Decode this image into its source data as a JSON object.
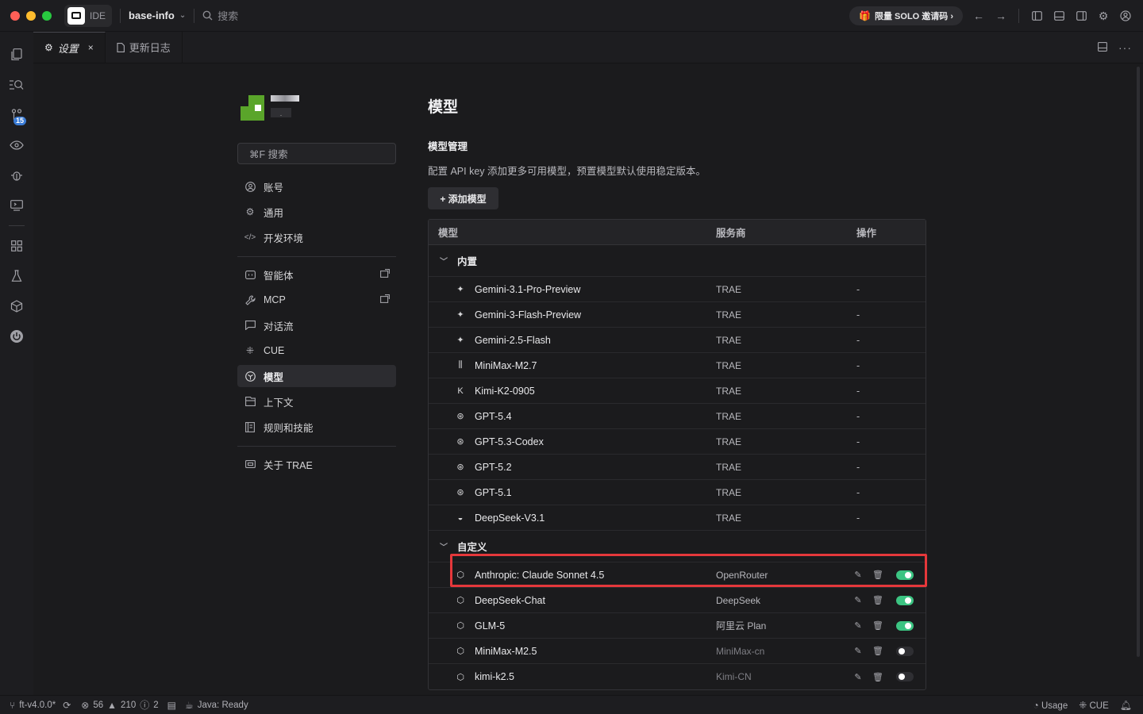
{
  "titlebar": {
    "app_label": "IDE",
    "project": "base-info",
    "search_placeholder": "搜索",
    "solo_badge": "限量 SOLO 邀请码 ›"
  },
  "activity": {
    "scm_badge": "15"
  },
  "tabs": [
    {
      "label": "设置",
      "close": "×"
    },
    {
      "label": "更新日志"
    }
  ],
  "settings_nav": {
    "search": "⌘F 搜索",
    "items": [
      {
        "label": "账号"
      },
      {
        "label": "通用"
      },
      {
        "label": "开发环境"
      },
      {
        "label": "智能体"
      },
      {
        "label": "MCP"
      },
      {
        "label": "对话流"
      },
      {
        "label": "CUE"
      },
      {
        "label": "模型"
      },
      {
        "label": "上下文"
      },
      {
        "label": "规则和技能"
      },
      {
        "label": "关于 TRAE"
      }
    ],
    "active": "模型"
  },
  "main": {
    "title": "模型",
    "section_title": "模型管理",
    "section_desc": "配置 API key 添加更多可用模型，预置模型默认使用稳定版本。",
    "add_button": "+ 添加模型",
    "table": {
      "headers": [
        "模型",
        "服务商",
        "操作"
      ],
      "groups": [
        {
          "label": "内置",
          "rows": [
            {
              "model": "Gemini-3.1-Pro-Preview",
              "vendor": "TRAE",
              "op": "-",
              "icon": "sparkle-icon"
            },
            {
              "model": "Gemini-3-Flash-Preview",
              "vendor": "TRAE",
              "op": "-",
              "icon": "sparkle-icon"
            },
            {
              "model": "Gemini-2.5-Flash",
              "vendor": "TRAE",
              "op": "-",
              "icon": "sparkle-icon"
            },
            {
              "model": "MiniMax-M2.7",
              "vendor": "TRAE",
              "op": "-",
              "icon": "waveform-icon"
            },
            {
              "model": "Kimi-K2-0905",
              "vendor": "TRAE",
              "op": "-",
              "icon": "kimi-icon"
            },
            {
              "model": "GPT-5.4",
              "vendor": "TRAE",
              "op": "-",
              "icon": "openai-icon"
            },
            {
              "model": "GPT-5.3-Codex",
              "vendor": "TRAE",
              "op": "-",
              "icon": "openai-icon"
            },
            {
              "model": "GPT-5.2",
              "vendor": "TRAE",
              "op": "-",
              "icon": "openai-icon"
            },
            {
              "model": "GPT-5.1",
              "vendor": "TRAE",
              "op": "-",
              "icon": "openai-icon"
            },
            {
              "model": "DeepSeek-V3.1",
              "vendor": "TRAE",
              "op": "-",
              "icon": "deepseek-icon"
            }
          ]
        },
        {
          "label": "自定义",
          "rows": [
            {
              "model": "Anthropic: Claude Sonnet 4.5",
              "vendor": "OpenRouter",
              "enabled": true,
              "icon": "cube-icon"
            },
            {
              "model": "DeepSeek-Chat",
              "vendor": "DeepSeek",
              "enabled": true,
              "icon": "cube-icon"
            },
            {
              "model": "GLM-5",
              "vendor": "阿里云 Plan",
              "enabled": true,
              "icon": "cube-icon"
            },
            {
              "model": "MiniMax-M2.5",
              "vendor": "MiniMax-cn",
              "enabled": false,
              "icon": "cube-icon"
            },
            {
              "model": "kimi-k2.5",
              "vendor": "Kimi-CN",
              "enabled": false,
              "icon": "cube-icon"
            }
          ]
        }
      ]
    }
  },
  "statusbar": {
    "branch": "ft-v4.0.0*",
    "errors": "56",
    "warnings": "210",
    "infos": "2",
    "java": "Java: Ready",
    "usage": "Usage",
    "cue": "CUE"
  },
  "colors": {
    "accent_toggle": "#3cc482",
    "highlight": "#e5383b",
    "background": "#1b1b1d"
  }
}
